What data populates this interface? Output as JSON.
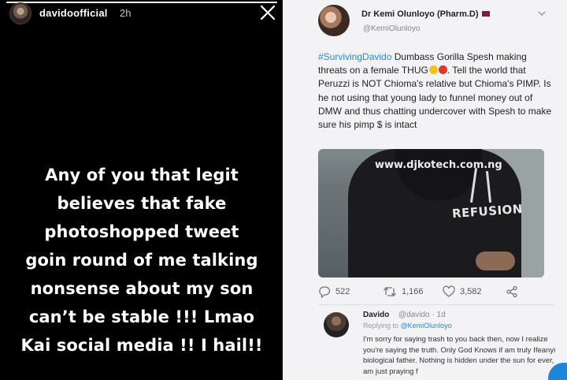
{
  "story": {
    "username": "davidoofficial",
    "time": "2h",
    "progress": 1.0,
    "text_lines": [
      "Any of you that legit",
      "believes that fake",
      "photoshopped tweet",
      "goin round of me talking",
      "nonsense about my son",
      "can’t be stable !!! Lmao",
      "Kai social media !! I hail!!"
    ]
  },
  "tweet": {
    "author_name": "Dr Kemi Olunloyo (Pharm.D)",
    "author_handle": "@KemiOlunloyo",
    "hashtag": "#SurvivingDavido",
    "body_part1": " Dumbass Gorilla Spesh making threats on a female THUG",
    "body_part2": ". Tell the world that Peruzzi is NOT Chioma's relative but Chioma's PIMP. Is he not using that young lady to funnel money out of DMW and thus chatting undercover with Spesh to make sure his pimp $ is intact",
    "image_watermark": "www.djkotech.com.ng",
    "image_brand_text": "REFUSION",
    "replies_count": "522",
    "retweets_count": "1,166",
    "likes_count": "3,582"
  },
  "reply": {
    "name": "Davido",
    "handle": "@davido · 1d",
    "replying_prefix": "Replying to ",
    "replying_mention": "@KemiOlunloyo",
    "body": "I'm sorry for saying trash to you back then, now I realize you're saying the truth. Only God Knows if am truly Ifeanyi biological father. Nothing is hidden under the sun for ever, am just praying f"
  },
  "icons": {
    "story_close": "close-icon",
    "tweet_menu": "chevron-down-icon",
    "reply": "reply-icon",
    "retweet": "retweet-icon",
    "like": "heart-icon",
    "share": "share-icon"
  },
  "colors": {
    "story_bg": "#000000",
    "tweet_bg": "#f3f2f4",
    "link_blue": "#1d8fd6"
  }
}
